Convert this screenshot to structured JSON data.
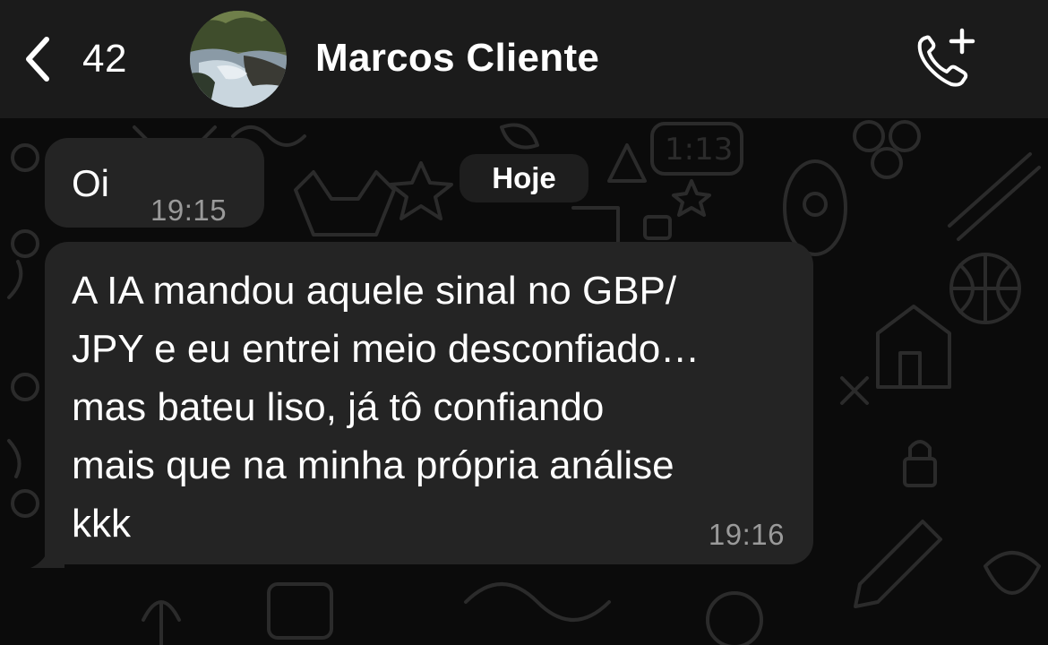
{
  "header": {
    "back_count": "42",
    "contact_name": "Marcos Cliente",
    "icons": {
      "back": "chevron-left-icon",
      "call": "add-call-icon"
    }
  },
  "chat": {
    "date_chip": "Hoje",
    "messages": [
      {
        "text": "Oi",
        "time": "19:15",
        "direction": "incoming"
      },
      {
        "text": "A IA mandou aquele sinal no GBP/\nJPY e eu entrei meio desconfiado…\nmas bateu liso, já tô confiando\nmais que na minha própria análise\nkkk",
        "time": "19:16",
        "direction": "incoming"
      }
    ]
  },
  "colors": {
    "header_bg": "#1b1b1b",
    "chat_bg": "#0b0b0b",
    "bubble_bg": "#242424",
    "time_text": "#9a9a9a",
    "wallpaper_doodle": "#2a2a2a"
  }
}
